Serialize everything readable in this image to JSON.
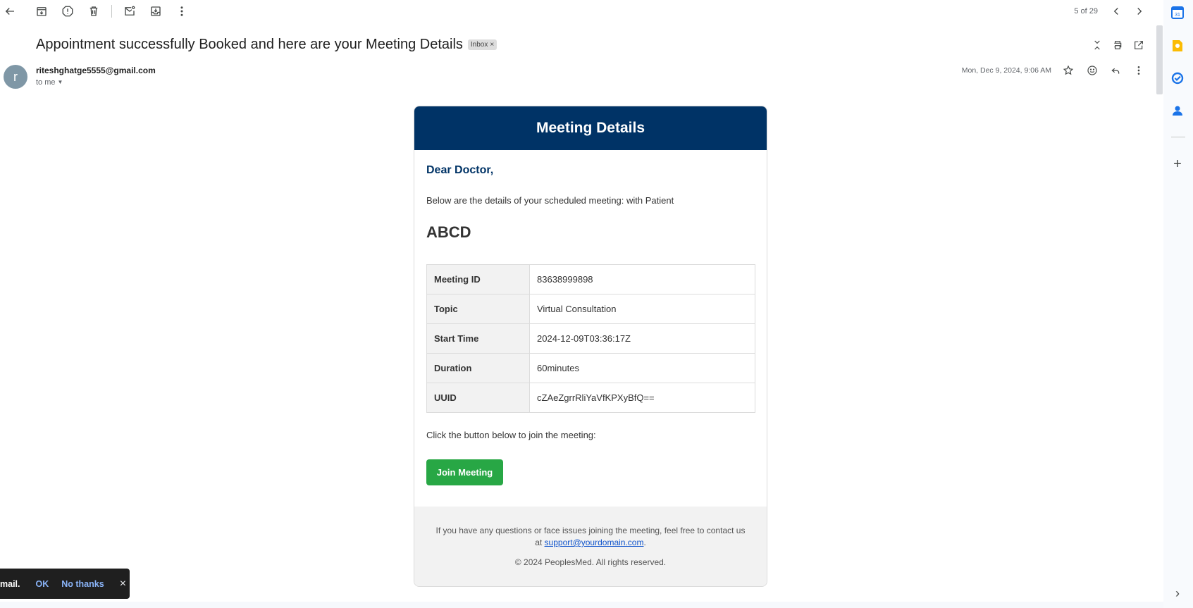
{
  "toolbar": {
    "back": "back-arrow-icon",
    "pager_text": "5 of 29"
  },
  "message": {
    "subject": "Appointment successfully Booked and here are your Meeting Details",
    "label": "Inbox",
    "label_remove": "×",
    "sender_initial": "r",
    "sender_email": "riteshghatge5555@gmail.com",
    "recipient": "to me",
    "date": "Mon, Dec 9, 2024, 9:06 AM"
  },
  "email": {
    "header_title": "Meeting Details",
    "greeting": "Dear Doctor,",
    "intro": "Below are the details of your scheduled meeting: with Patient",
    "patient": "ABCD",
    "details": [
      {
        "key": "Meeting ID",
        "value": "83638999898"
      },
      {
        "key": "Topic",
        "value": "Virtual Consultation"
      },
      {
        "key": "Start Time",
        "value": "2024-12-09T03:36:17Z"
      },
      {
        "key": "Duration",
        "value": "60minutes"
      },
      {
        "key": "UUID",
        "value": "cZAeZgrrRliYaVfKPXyBfQ=="
      }
    ],
    "click_text": "Click the button below to join the meeting:",
    "join_button": "Join Meeting",
    "footer_text": "If you have any questions or face issues joining the meeting, feel free to contact us at",
    "footer_link": "support@yourdomain.com",
    "footer_period": ".",
    "copyright": "© 2024 PeoplesMed. All rights reserved."
  },
  "snackbar": {
    "message": "mail.",
    "ok": "OK",
    "no_thanks": "No thanks",
    "close": "×"
  },
  "rail": {
    "add": "+",
    "expand": "›"
  },
  "colors": {
    "header_bg": "#003366",
    "join_button": "#28a745",
    "link": "#1155cc"
  }
}
